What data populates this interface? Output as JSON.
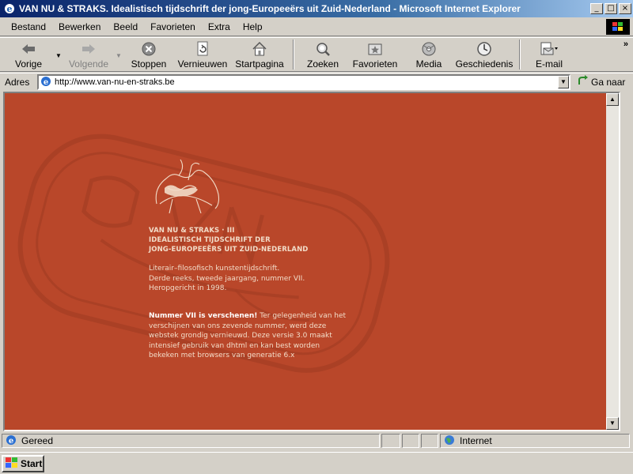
{
  "window": {
    "title": "VAN NU & STRAKS. Idealistisch tijdschrift der jong-Europeeërs uit Zuid-Nederland - Microsoft Internet Explorer"
  },
  "menu": [
    "Bestand",
    "Bewerken",
    "Beeld",
    "Favorieten",
    "Extra",
    "Help"
  ],
  "toolbar": {
    "back": "Vorige",
    "forward": "Volgende",
    "stop": "Stoppen",
    "refresh": "Vernieuwen",
    "home": "Startpagina",
    "search": "Zoeken",
    "favorites": "Favorieten",
    "media": "Media",
    "history": "Geschiedenis",
    "mail": "E-mail",
    "more": "»"
  },
  "address": {
    "label": "Adres",
    "url": "http://www.van-nu-en-straks.be",
    "go": "Ga naar"
  },
  "page": {
    "heading_1": "VAN NU & STRAKS · III",
    "heading_2": "IDEALISTISCH TIJDSCHRIFT DER",
    "heading_3": "JONG-EUROPEEËRS UIT ZUID-NEDERLAND",
    "intro_1": "Literair–filosofisch kunstentijdschrift.",
    "intro_2": "Derde reeks, tweede jaargang, nummer VII.",
    "intro_3": "Heropgericht in 1998.",
    "news_bold": "Nummer VII is verschenen!",
    "news_text": " Ter gelegenheid van het verschijnen van ons zevende nummer, werd deze webstek grondig vernieuwd. Deze versie 3.0 maakt intensief gebruik van dhtml en kan best worden bekeken met browsers van generatie 6.x",
    "background_color": "#b9472a"
  },
  "status": {
    "text": "Gereed",
    "zone": "Internet"
  },
  "taskbar": {
    "start": "Start"
  }
}
